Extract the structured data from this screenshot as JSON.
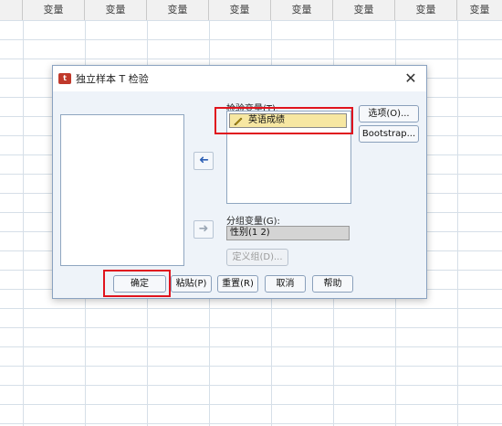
{
  "spreadsheet": {
    "column_headers": [
      "变量",
      "变量",
      "变量",
      "变量",
      "变量",
      "变量",
      "变量",
      "变量"
    ]
  },
  "dialog": {
    "title": "独立样本 T 检验",
    "close_glyph": "✕",
    "test_variable_label": "检验变量(T):",
    "test_variable_selected": "英语成绩",
    "grouping_variable_label": "分组变量(G):",
    "grouping_variable_value": "性别(1 2)",
    "buttons": {
      "options": "选项(O)...",
      "bootstrap": "Bootstrap...",
      "define_groups": "定义组(D)...",
      "ok": "确定",
      "paste": "粘贴(P)",
      "reset": "重置(R)",
      "cancel": "取消",
      "help": "帮助"
    },
    "arrow_glyph": "➜"
  },
  "colors": {
    "highlight": "#e0141e",
    "selected_row": "#f7e7a2",
    "dialog_body": "#eef3f9"
  }
}
